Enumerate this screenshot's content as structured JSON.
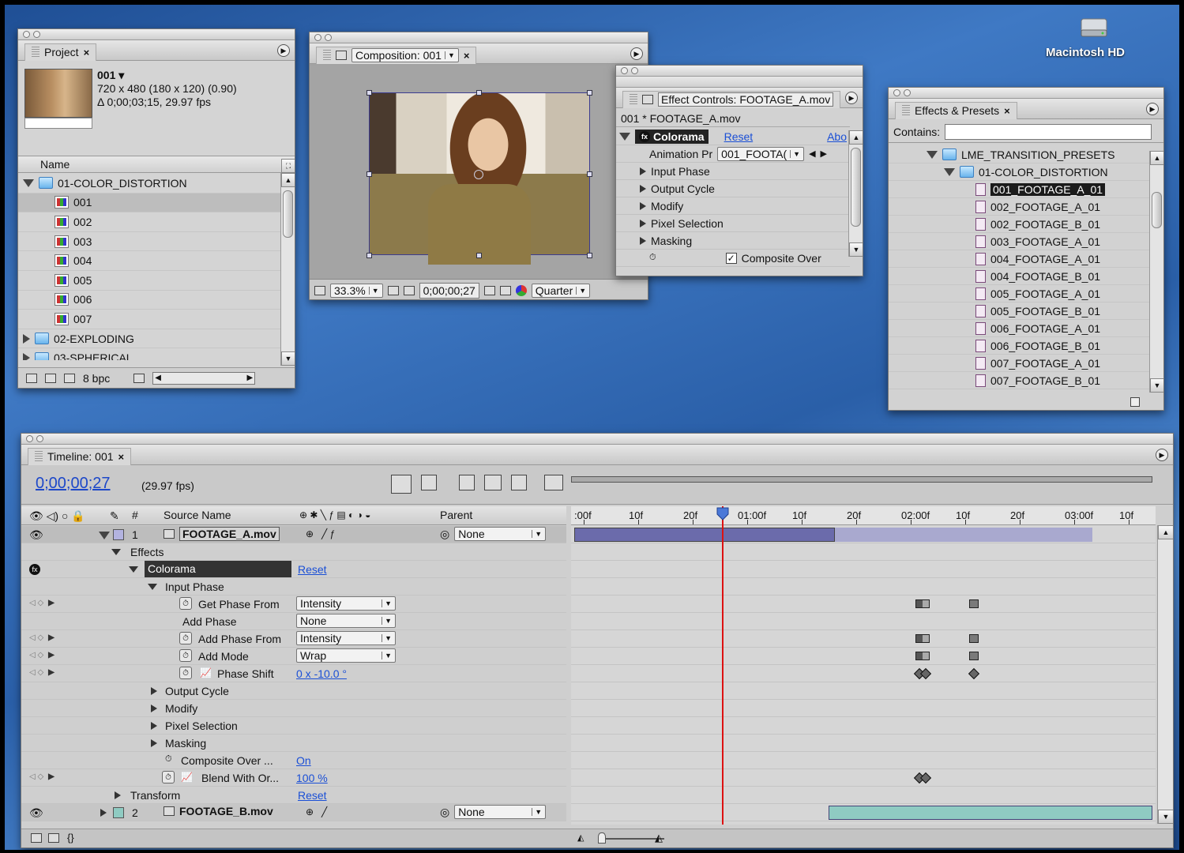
{
  "desktop": {
    "hd_label": "Macintosh HD"
  },
  "project": {
    "tab": "Project",
    "item_name": "001 ▾",
    "item_specs": "720 x 480  (180 x 120) (0.90)",
    "item_duration": "Δ 0;00;03;15, 29.97 fps",
    "col_name": "Name",
    "rows": [
      {
        "label": "01-COLOR_DISTORTION",
        "kind": "folder",
        "open": true,
        "indent": 0
      },
      {
        "label": "001",
        "kind": "comp",
        "indent": 1,
        "selected": true
      },
      {
        "label": "002",
        "kind": "comp",
        "indent": 1
      },
      {
        "label": "003",
        "kind": "comp",
        "indent": 1
      },
      {
        "label": "004",
        "kind": "comp",
        "indent": 1
      },
      {
        "label": "005",
        "kind": "comp",
        "indent": 1
      },
      {
        "label": "006",
        "kind": "comp",
        "indent": 1
      },
      {
        "label": "007",
        "kind": "comp",
        "indent": 1
      },
      {
        "label": "02-EXPLODING",
        "kind": "folder",
        "open": false,
        "indent": 0
      },
      {
        "label": "03-SPHERICAL",
        "kind": "folder",
        "open": false,
        "indent": 0
      }
    ],
    "bpc": "8 bpc"
  },
  "composition": {
    "tab": "Composition: 001",
    "zoom": "33.3%",
    "timecode": "0;00;00;27",
    "resolution": "Quarter"
  },
  "effect_controls": {
    "tab": "Effect Controls: FOOTAGE_A.mov",
    "layer": "001 * FOOTAGE_A.mov",
    "effect_name": "Colorama",
    "reset": "Reset",
    "about": "Abo",
    "anim_label": "Animation Pr",
    "anim_value": "001_FOOTA(",
    "groups": [
      "Input Phase",
      "Output Cycle",
      "Modify",
      "Pixel Selection",
      "Masking"
    ],
    "composite_over": "Composite Over"
  },
  "presets": {
    "tab": "Effects & Presets",
    "contains_label": "Contains:",
    "root": "LME_TRANSITION_PRESETS",
    "folder": "01-COLOR_DISTORTION",
    "items": [
      "001_FOOTAGE_A_01",
      "002_FOOTAGE_A_01",
      "002_FOOTAGE_B_01",
      "003_FOOTAGE_A_01",
      "004_FOOTAGE_A_01",
      "004_FOOTAGE_B_01",
      "005_FOOTAGE_A_01",
      "005_FOOTAGE_B_01",
      "006_FOOTAGE_A_01",
      "006_FOOTAGE_B_01",
      "007_FOOTAGE_A_01",
      "007_FOOTAGE_B_01"
    ]
  },
  "timeline": {
    "tab": "Timeline: 001",
    "timecode": "0;00;00;27",
    "fps": "(29.97 fps)",
    "col_hash": "#",
    "col_source": "Source Name",
    "col_parent": "Parent",
    "ruler": [
      ":00f",
      "10f",
      "20f",
      "01:00f",
      "10f",
      "20f",
      "02:00f",
      "10f",
      "20f",
      "03:00f",
      "10f"
    ],
    "layer1": {
      "num": "1",
      "name": "FOOTAGE_A.mov",
      "parent": "None"
    },
    "layer2": {
      "num": "2",
      "name": "FOOTAGE_B.mov",
      "parent": "None"
    },
    "props": {
      "effects": "Effects",
      "colorama": "Colorama",
      "reset": "Reset",
      "input_phase": "Input Phase",
      "get_phase_from": "Get Phase From",
      "get_phase_from_val": "Intensity",
      "add_phase": "Add Phase",
      "add_phase_val": "None",
      "add_phase_from": "Add Phase From",
      "add_phase_from_val": "Intensity",
      "add_mode": "Add Mode",
      "add_mode_val": "Wrap",
      "phase_shift": "Phase Shift",
      "phase_shift_val": "0 x -10.0 °",
      "output_cycle": "Output Cycle",
      "modify": "Modify",
      "pixel_selection": "Pixel Selection",
      "masking": "Masking",
      "composite_over": "Composite Over ...",
      "composite_over_val": "On",
      "blend_with": "Blend With Or...",
      "blend_with_val": "100 %",
      "transform": "Transform",
      "transform_reset": "Reset"
    }
  },
  "colors": {
    "accent_link": "#1a4fd6",
    "playhead": "#dd1111",
    "layer1_bar": "#6b6bab",
    "layer2_bar": "#8fcbc2"
  }
}
